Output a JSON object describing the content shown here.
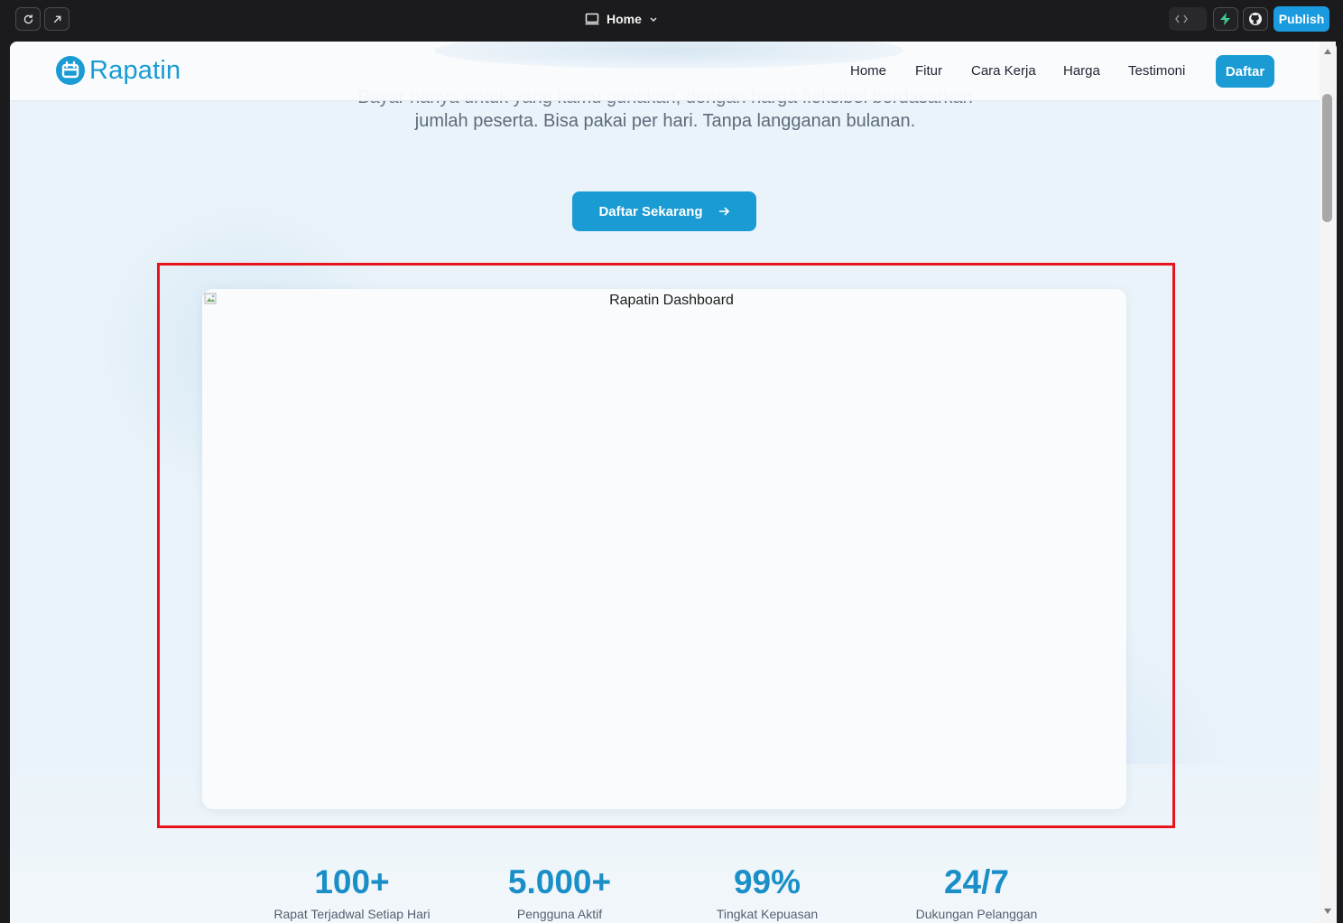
{
  "toolbar": {
    "page_name": "Home",
    "publish_label": "Publish"
  },
  "navbar": {
    "brand": "Rapatin",
    "links": [
      "Home",
      "Fitur",
      "Cara Kerja",
      "Harga",
      "Testimoni"
    ],
    "cta_label": "Daftar"
  },
  "hero": {
    "subtitle_line1": "Bayar hanya untuk yang kamu gunakan, dengan harga fleksibel berdasarkan",
    "subtitle_line2": "jumlah peserta. Bisa pakai per hari. Tanpa langganan bulanan.",
    "cta_label": "Daftar Sekarang",
    "dashboard_alt": "Rapatin Dashboard"
  },
  "stats": [
    {
      "value": "100+",
      "label": "Rapat Terjadwal Setiap Hari"
    },
    {
      "value": "5.000+",
      "label": "Pengguna Aktif"
    },
    {
      "value": "99%",
      "label": "Tingkat Kepuasan"
    },
    {
      "value": "24/7",
      "label": "Dukungan Pelanggan"
    }
  ],
  "colors": {
    "accent": "#1a9bd3",
    "highlight_border": "#e8141b",
    "toolbar_bg": "#1b1b1d",
    "publish": "#1a9be0"
  },
  "icons": {
    "refresh": "refresh-icon",
    "open_external": "external-link-icon",
    "monitor": "monitor-icon",
    "chevron": "chevron-down-icon",
    "code": "code-icon",
    "bolt": "bolt-icon",
    "github": "github-icon",
    "arrow": "arrow-right-icon",
    "logo": "calendar-logo-icon"
  }
}
